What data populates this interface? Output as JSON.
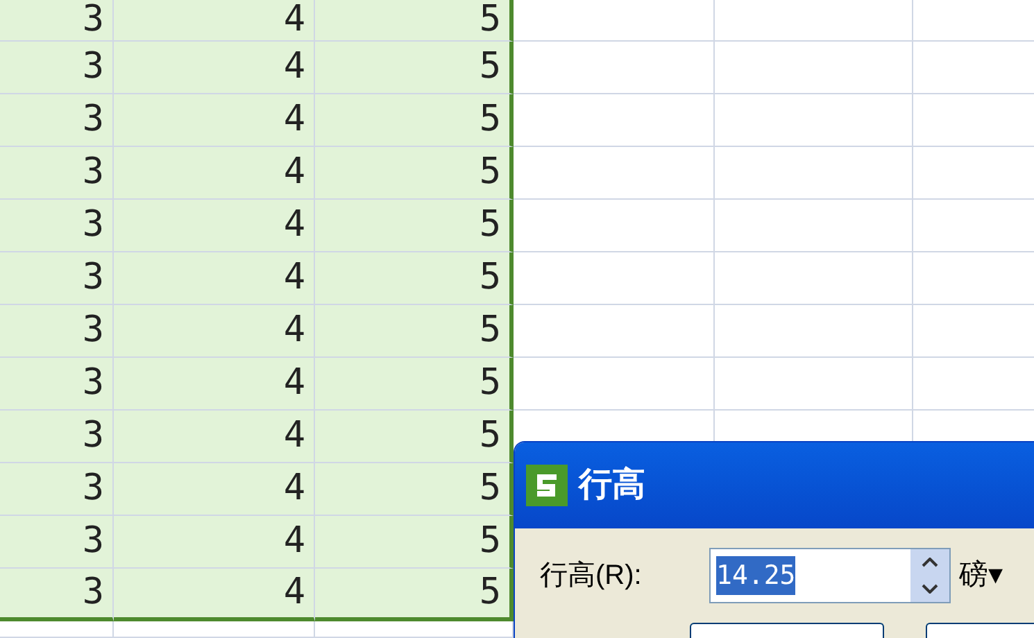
{
  "sheet": {
    "rows": [
      {
        "cells": [
          "3",
          "4",
          "5"
        ],
        "selected": true
      },
      {
        "cells": [
          "3",
          "4",
          "5"
        ],
        "selected": true
      },
      {
        "cells": [
          "3",
          "4",
          "5"
        ],
        "selected": true
      },
      {
        "cells": [
          "3",
          "4",
          "5"
        ],
        "selected": true
      },
      {
        "cells": [
          "3",
          "4",
          "5"
        ],
        "selected": true
      },
      {
        "cells": [
          "3",
          "4",
          "5"
        ],
        "selected": true
      },
      {
        "cells": [
          "3",
          "4",
          "5"
        ],
        "selected": true
      },
      {
        "cells": [
          "3",
          "4",
          "5"
        ],
        "selected": true
      },
      {
        "cells": [
          "3",
          "4",
          "5"
        ],
        "selected": true
      },
      {
        "cells": [
          "3",
          "4",
          "5"
        ],
        "selected": true
      },
      {
        "cells": [
          "3",
          "4",
          "5"
        ],
        "selected": true
      },
      {
        "cells": [
          "3",
          "4",
          "5"
        ],
        "selected": true
      },
      {
        "cells": [
          "",
          "",
          ""
        ],
        "selected": false
      }
    ]
  },
  "dialog": {
    "title": "行高",
    "label": "行高(R):",
    "value": "14.25",
    "value_selected": true,
    "unit": "磅▾"
  }
}
